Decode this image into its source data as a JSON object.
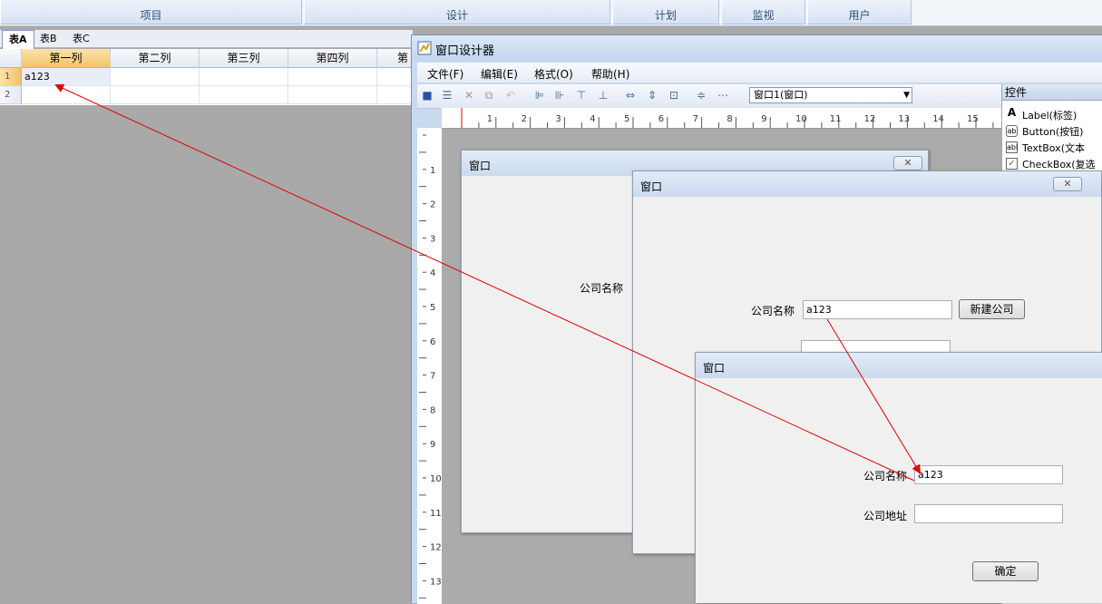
{
  "topbar": {
    "items": [
      "项目",
      "设计",
      "计划",
      "监视",
      "用户"
    ]
  },
  "sheet": {
    "tabs": [
      "表A",
      "表B",
      "表C"
    ],
    "columns": [
      "第一列",
      "第二列",
      "第三列",
      "第四列",
      "第"
    ],
    "rows": [
      "1",
      "2"
    ],
    "cell_a1": "a123"
  },
  "designer": {
    "title": "窗口设计器",
    "menu": [
      "文件(F)",
      "编辑(E)",
      "格式(O)",
      "帮助(H)"
    ],
    "combo": "窗口1(窗口)",
    "ruler_h": [
      "1",
      "2",
      "3",
      "4",
      "5",
      "6",
      "7",
      "8",
      "9",
      "10",
      "11",
      "12",
      "13",
      "14",
      "15",
      "16"
    ],
    "ruler_v": [
      "1",
      "2",
      "3",
      "4",
      "5",
      "6",
      "7",
      "8",
      "9",
      "10",
      "11",
      "12",
      "13"
    ],
    "panel": {
      "title": "控件",
      "items": [
        "Label(标签)",
        "Button(按钮)",
        "TextBox(文本",
        "CheckBox(复选"
      ]
    }
  },
  "form1": {
    "title": "窗口",
    "label": "公司名称"
  },
  "form2": {
    "title": "窗口",
    "label": "公司名称",
    "value": "a123",
    "button": "新建公司"
  },
  "form3": {
    "title": "窗口",
    "label1": "公司名称",
    "value1": "a123",
    "label2": "公司地址",
    "value2": "",
    "button": "确定"
  },
  "colors": {
    "accent": "#30507a",
    "arrow": "#e00000",
    "selected": "#f3c36a"
  }
}
